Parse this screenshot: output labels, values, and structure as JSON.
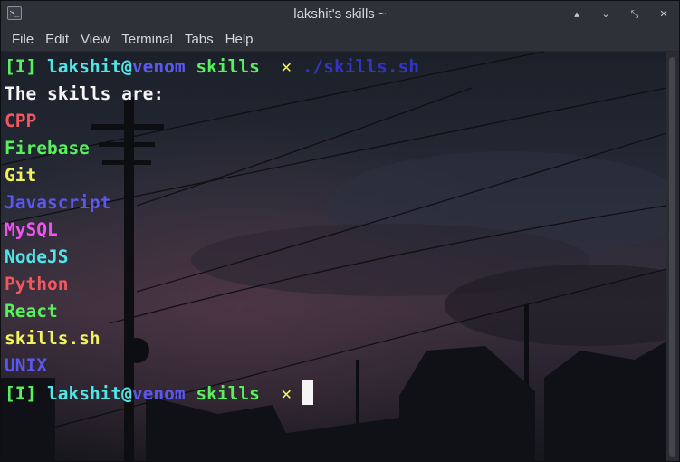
{
  "window": {
    "title": "lakshit's skills ~",
    "app_icon": ">_",
    "controls": {
      "shade_icon": "shade-icon",
      "minimize_icon": "minimize-icon",
      "maximize_icon": "maximize-icon",
      "close_icon": "close-icon"
    }
  },
  "menubar": {
    "items": [
      "File",
      "Edit",
      "View",
      "Terminal",
      "Tabs",
      "Help"
    ]
  },
  "colors": {
    "green": "#57f15d",
    "cyan": "#50e6e8",
    "blue": "#5c57ee",
    "yellow": "#f2f25a",
    "red": "#f3565e",
    "magenta": "#f252f2",
    "white": "#f5f5f5"
  },
  "terminal": {
    "prompt": {
      "indicator": "[I]",
      "user": "lakshit",
      "at": "@",
      "host": "venom",
      "dir": "skills",
      "symbol": "✕"
    },
    "command": "./skills.sh",
    "output_header": "The skills are:",
    "skills": [
      "CPP",
      "Firebase",
      "Git",
      "Javascript",
      "MySQL",
      "NodeJS",
      "Python",
      "React",
      "skills.sh",
      "UNIX"
    ]
  }
}
